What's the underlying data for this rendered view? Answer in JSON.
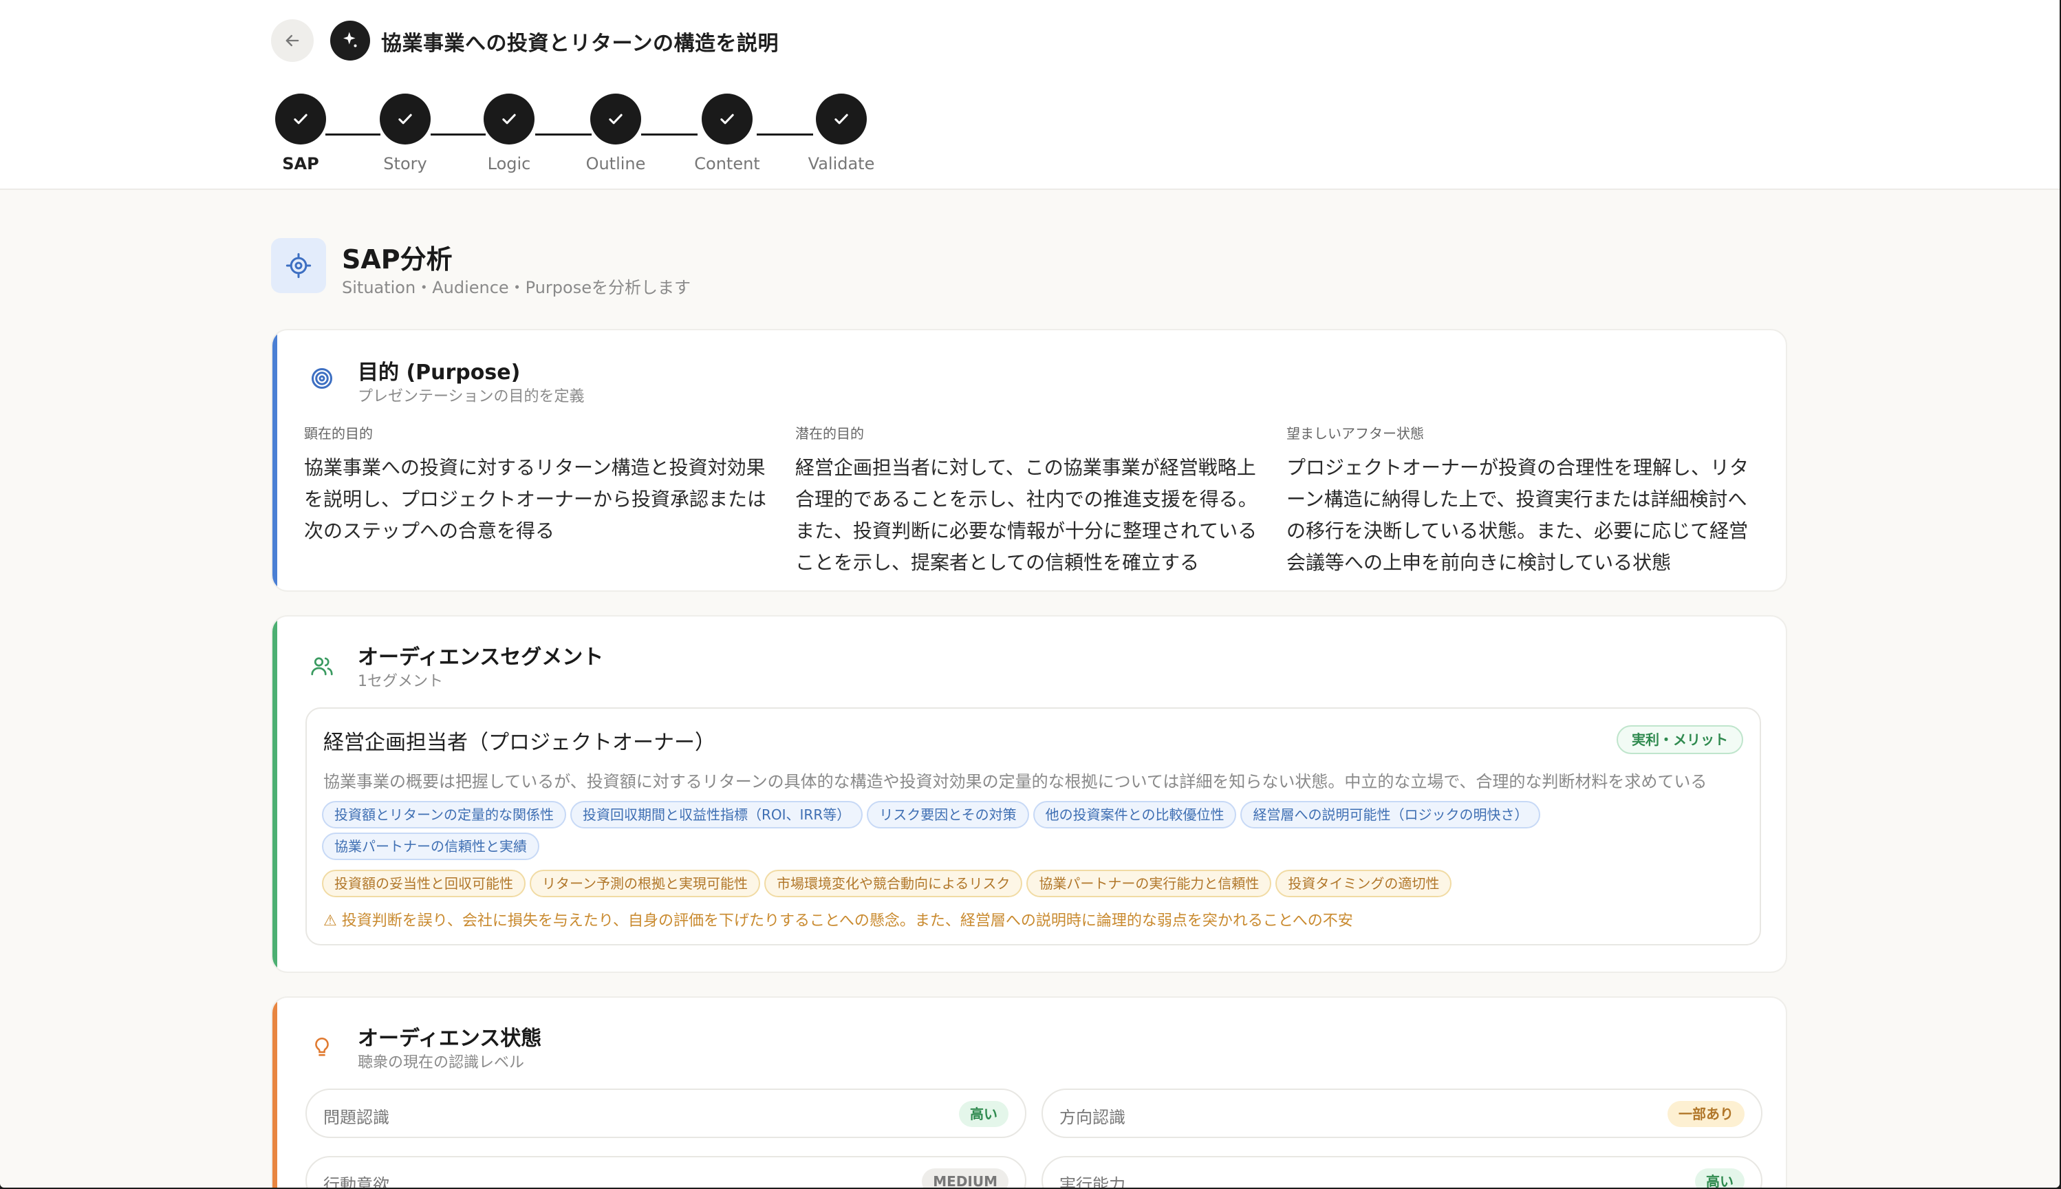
{
  "header": {
    "title": "協業事業への投資とリターンの構造を説明",
    "steps": [
      {
        "label": "SAP"
      },
      {
        "label": "Story"
      },
      {
        "label": "Logic"
      },
      {
        "label": "Outline"
      },
      {
        "label": "Content"
      },
      {
        "label": "Validate"
      }
    ]
  },
  "section": {
    "title": "SAP分析",
    "subtitle": "Situation・Audience・Purposeを分析します"
  },
  "purpose": {
    "title": "目的 (Purpose)",
    "subtitle": "プレゼンテーションの目的を定義",
    "columns": [
      {
        "label": "顕在的目的",
        "lines": [
          "協業事業への投資に対するリターン構造と投資対効果",
          "を説明し、プロジェクトオーナーから投資承認または",
          "次のステップへの合意を得る"
        ]
      },
      {
        "label": "潜在的目的",
        "lines": [
          "経営企画担当者に対して、この協業事業が経営戦略上",
          "合理的であることを示し、社内での推進支援を得る。",
          "また、投資判断に必要な情報が十分に整理されている",
          "ことを示し、提案者としての信頼性を確立する"
        ]
      },
      {
        "label": "望ましいアフター状態",
        "lines": [
          "プロジェクトオーナーが投資の合理性を理解し、リタ",
          "ーン構造に納得した上で、投資実行または詳細検討へ",
          "の移行を決断している状態。また、必要に応じて経営",
          "会議等への上申を前向きに検討している状態"
        ]
      }
    ]
  },
  "audience": {
    "title": "オーディエンスセグメント",
    "subtitle": "1セグメント",
    "segment": {
      "name": "経営企画担当者（プロジェクトオーナー）",
      "badge": "実利・メリット",
      "description": "協業事業の概要は把握しているが、投資額に対するリターンの具体的な構造や投資対効果の定量的な根拠については詳細を知らない状態。中立的な立場で、合理的な判断材料を求めている",
      "interests": [
        "投資額とリターンの定量的な関係性",
        "投資回収期間と収益性指標（ROI、IRR等）",
        "リスク要因とその対策",
        "他の投資案件との比較優位性",
        "経営層への説明可能性（ロジックの明快さ）",
        "協業パートナーの信頼性と実績"
      ],
      "concerns": [
        "投資額の妥当性と回収可能性",
        "リターン予測の根拠と実現可能性",
        "市場環境変化や競合動向によるリスク",
        "協業パートナーの実行能力と信頼性",
        "投資タイミングの適切性"
      ],
      "warning": "⚠ 投資判断を誤り、会社に損失を与えたり、自身の評価を下げたりすることへの懸念。また、経営層への説明時に論理的な弱点を突かれることへの不安"
    }
  },
  "state": {
    "title": "オーディエンス状態",
    "subtitle": "聴衆の現在の認識レベル",
    "items": [
      {
        "label": "問題認識",
        "badge": "高い"
      },
      {
        "label": "方向認識",
        "badge": "一部あり"
      },
      {
        "label": "行動意欲",
        "badge": "MEDIUM"
      },
      {
        "label": "実行能力",
        "badge": "高い"
      }
    ]
  }
}
